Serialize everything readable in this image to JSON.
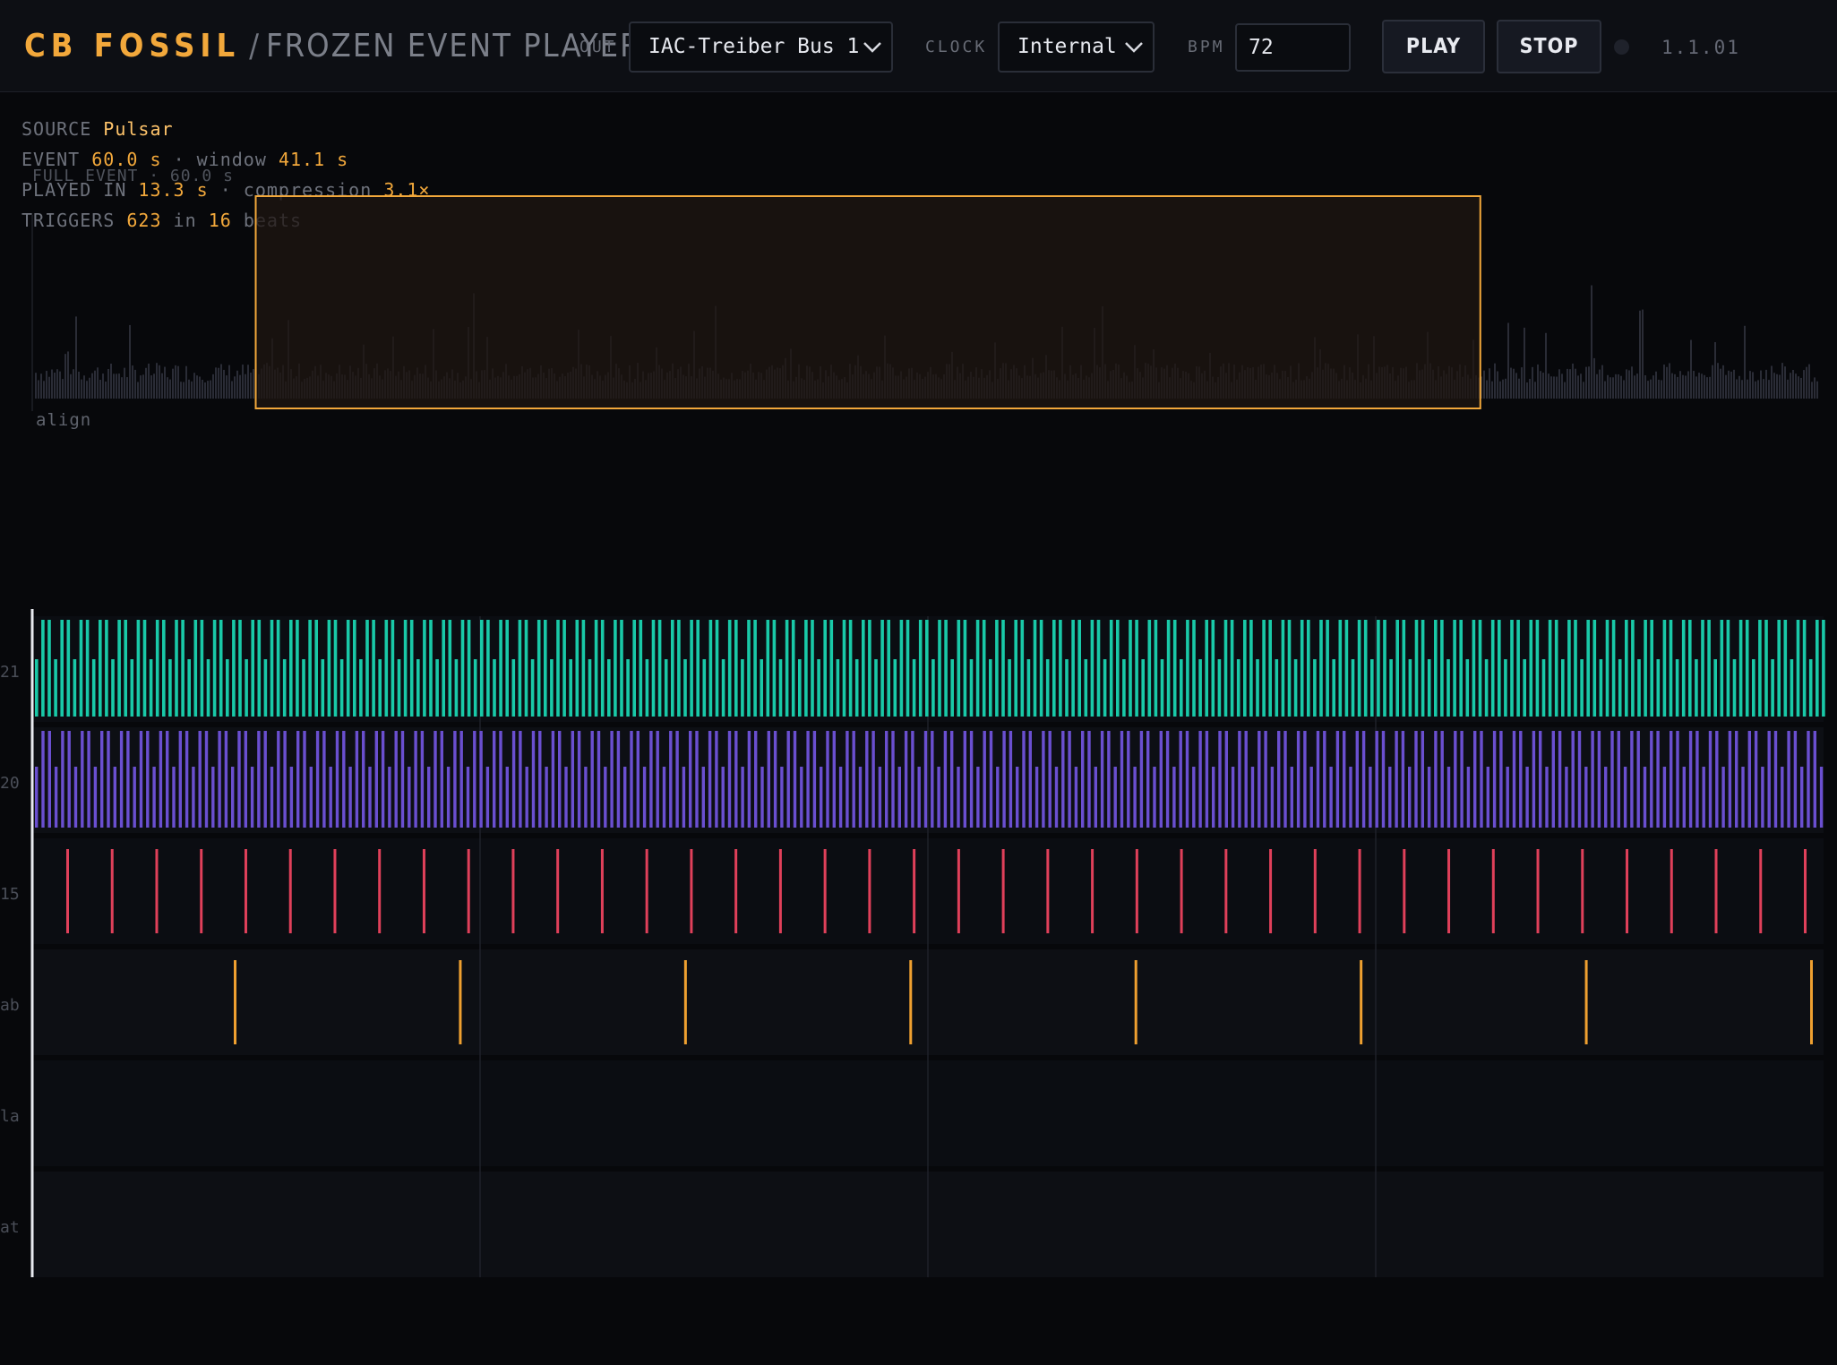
{
  "header": {
    "brand_name": "CB FOSSIL",
    "brand_separator": "/",
    "brand_subtitle": "FROZEN EVENT PLAYER",
    "out_label": "OUT",
    "out_value": "IAC-Treiber Bus 1",
    "clock_label": "CLOCK",
    "clock_value": "Internal",
    "bpm_label": "BPM",
    "bpm_value": "72",
    "play_label": "PLAY",
    "stop_label": "STOP",
    "version": "1.1.01"
  },
  "info": {
    "source_label": "SOURCE",
    "source_value": "Pulsar",
    "event_label": "EVENT",
    "event_value": "60.0 s",
    "window_label": "· window",
    "window_value": "41.1 s",
    "full_event_text": "FULL EVENT · 60.0 s",
    "played_label": "PLAYED IN",
    "played_value": "13.3 s",
    "compression_label": "· compression",
    "compression_value": "3.1×",
    "triggers_label": "TRIGGERS",
    "triggers_value": "623",
    "triggers_in": "in",
    "beats_value": "16",
    "beats_label": "beats"
  },
  "overview": {
    "full_event_seconds": 60.0,
    "window_start_fraction": 0.125,
    "window_end_fraction": 0.81,
    "align_label": "align"
  },
  "lanes": {
    "labels": [
      "21",
      "20",
      "15",
      "ab",
      "la",
      "at"
    ],
    "beats": 16,
    "colors": {
      "lane1": "#19c9a8",
      "lane2": "#6a4fd0",
      "lane3": "#e0405a",
      "lane4": "#efa030",
      "window_fill": "#1f1612",
      "window_stroke": "#f2a83b",
      "accent": "#f2a83b"
    }
  }
}
